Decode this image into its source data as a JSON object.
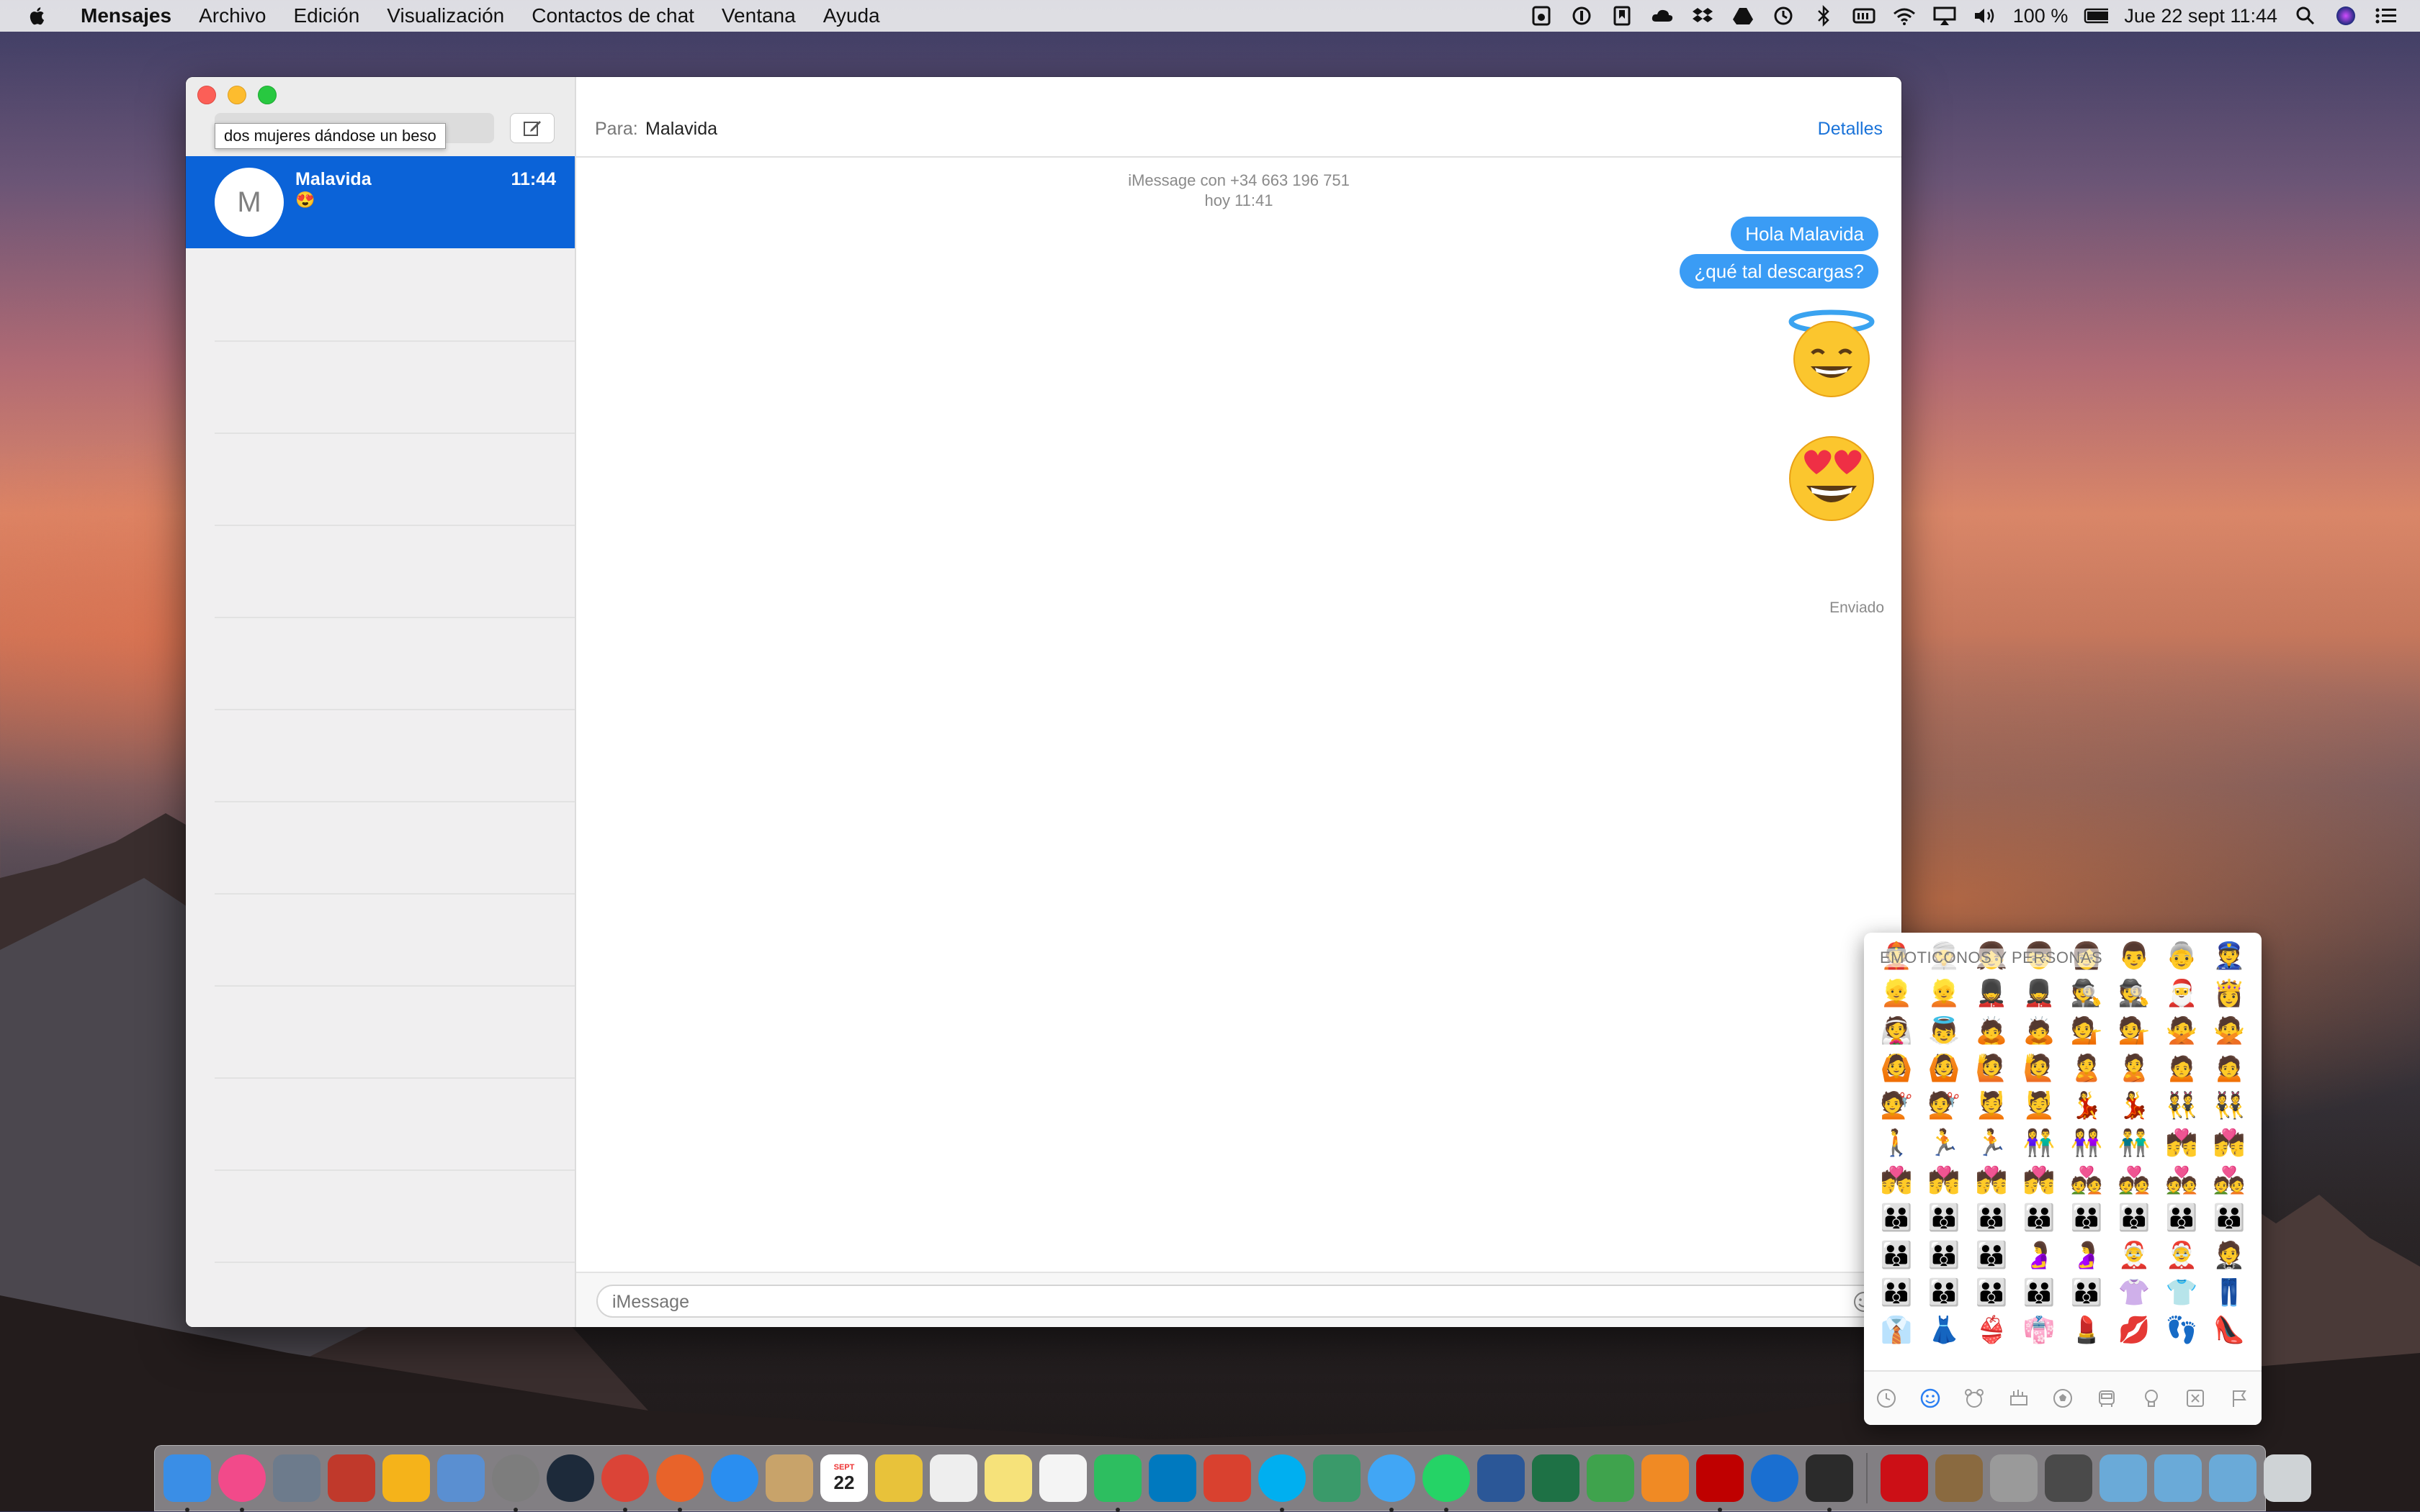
{
  "menubar": {
    "app_name": "Mensajes",
    "items": [
      "Archivo",
      "Edición",
      "Visualización",
      "Contactos de chat",
      "Ventana",
      "Ayuda"
    ],
    "battery": "100 %",
    "datetime": "Jue 22 sept  11:44"
  },
  "sidebar": {
    "search_tooltip": "dos mujeres dándose un beso",
    "conversations": [
      {
        "initial": "M",
        "name": "Malavida",
        "time": "11:44",
        "preview": "😍"
      }
    ]
  },
  "header": {
    "to_label": "Para:",
    "to_name": "Malavida",
    "details_label": "Detalles"
  },
  "thread": {
    "service_line": "iMessage con +34 663 196 751",
    "date_line": "hoy 11:41",
    "messages": [
      {
        "type": "text",
        "text": "Hola Malavida"
      },
      {
        "type": "text",
        "text": "¿qué tal descargas?"
      },
      {
        "type": "emoji",
        "icon": "smiling-face-with-halo"
      },
      {
        "type": "emoji",
        "icon": "smiling-face-with-heart-eyes"
      }
    ],
    "status": "Enviado"
  },
  "input": {
    "placeholder": "iMessage"
  },
  "emoji_picker": {
    "section_title": "EMOTICONOS Y PERSONAS",
    "tabs": [
      "recent-icon",
      "smileys-icon",
      "animals-icon",
      "food-icon",
      "activity-icon",
      "travel-icon",
      "objects-icon",
      "symbols-icon",
      "flags-icon"
    ],
    "selected_tab": "smileys-icon",
    "rows": [
      "👲👳👧👦👩👨👵👮",
      "👱👱💂💂🕵🕵🎅👸",
      "👰👼🙇🙇💁💁🙅🙅",
      "🙆🙆🙋🙋🙎🙎🙍🙍",
      "💇💇💆💆💃💃👯👯",
      "🚶🏃🏃👫👭👬💏💏",
      "💏💏💏💏💑💑💑💑",
      "👪👪👪👪👪👪👪👪",
      "👪👪👪🤰🤰🤶🤶🤵",
      "👪👪👪👪👪👚👕👖",
      "👔👗👙👘💄💋👣👠"
    ]
  },
  "dock": {
    "apps": [
      "finder-icon",
      "itunes-icon",
      "launchpad-icon",
      "photo-booth-icon",
      "opera-neon-icon",
      "preview-icon",
      "system-preferences-icon",
      "clock-icon",
      "chrome-icon",
      "firefox-icon",
      "safari-icon",
      "notefile-icon",
      "calendar-icon",
      "wunderlist-icon",
      "textedit-icon",
      "notes-icon",
      "reminders-icon",
      "evernote-icon",
      "trello-icon",
      "wunderlist-star-icon",
      "skype-icon",
      "scrivener-icon",
      "messages-icon",
      "whatsapp-icon",
      "word-icon",
      "excel-icon",
      "numbers-icon",
      "pages-icon",
      "filezilla-icon",
      "1password-icon",
      "terminal-icon",
      "opera-icon",
      "folder-icon",
      "tools-icon",
      "screen-icon",
      "desktop-icon",
      "documents-icon",
      "downloads-icon",
      "trash-icon"
    ],
    "calendar_day": "22",
    "calendar_month": "SEPT"
  }
}
